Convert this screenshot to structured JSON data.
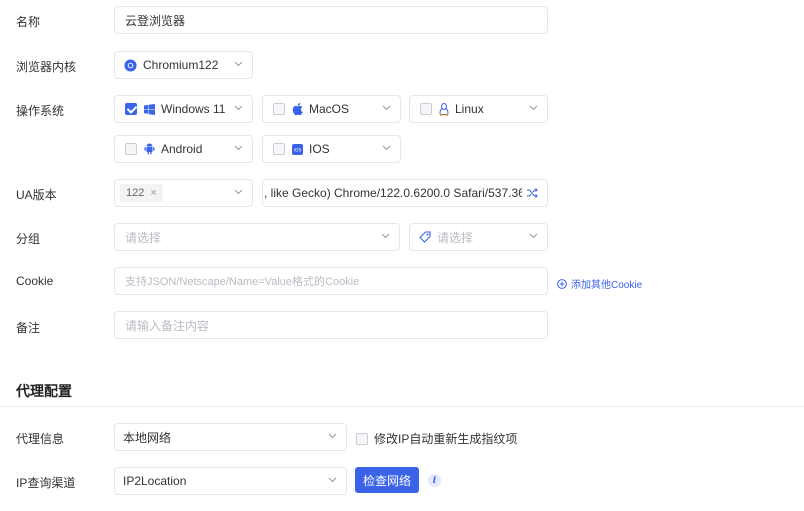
{
  "fields": {
    "name": {
      "label": "名称",
      "value": "云登浏览器"
    },
    "kernel": {
      "label": "浏览器内核",
      "value": "Chromium122"
    },
    "os": {
      "label": "操作系统",
      "options": [
        {
          "name": "Windows 11",
          "checked": true
        },
        {
          "name": "MacOS",
          "checked": false
        },
        {
          "name": "Linux",
          "checked": false
        },
        {
          "name": "Android",
          "checked": false
        },
        {
          "name": "IOS",
          "checked": false
        }
      ]
    },
    "ua": {
      "label": "UA版本",
      "tag": "122",
      "tag_remove": "×",
      "value": ", like Gecko) Chrome/122.0.6200.0 Safari/537.36"
    },
    "group": {
      "label": "分组",
      "placeholder": "请选择",
      "tag_placeholder": "请选择"
    },
    "cookie": {
      "label": "Cookie",
      "placeholder": "支持JSON/Netscape/Name=Value格式的Cookie",
      "add_link": "添加其他Cookie"
    },
    "note": {
      "label": "备注",
      "placeholder": "请输入备注内容"
    }
  },
  "proxy": {
    "section_title": "代理配置",
    "info": {
      "label": "代理信息",
      "value": "本地网络",
      "checkbox_label": "修改IP自动重新生成指纹项"
    },
    "channel": {
      "label": "IP查询渠道",
      "value": "IP2Location",
      "check_button": "检查网络",
      "info_icon": "i"
    }
  },
  "colors": {
    "accent": "#3a63e8",
    "border": "#e4e6eb",
    "placeholder": "#b8bcc4"
  }
}
